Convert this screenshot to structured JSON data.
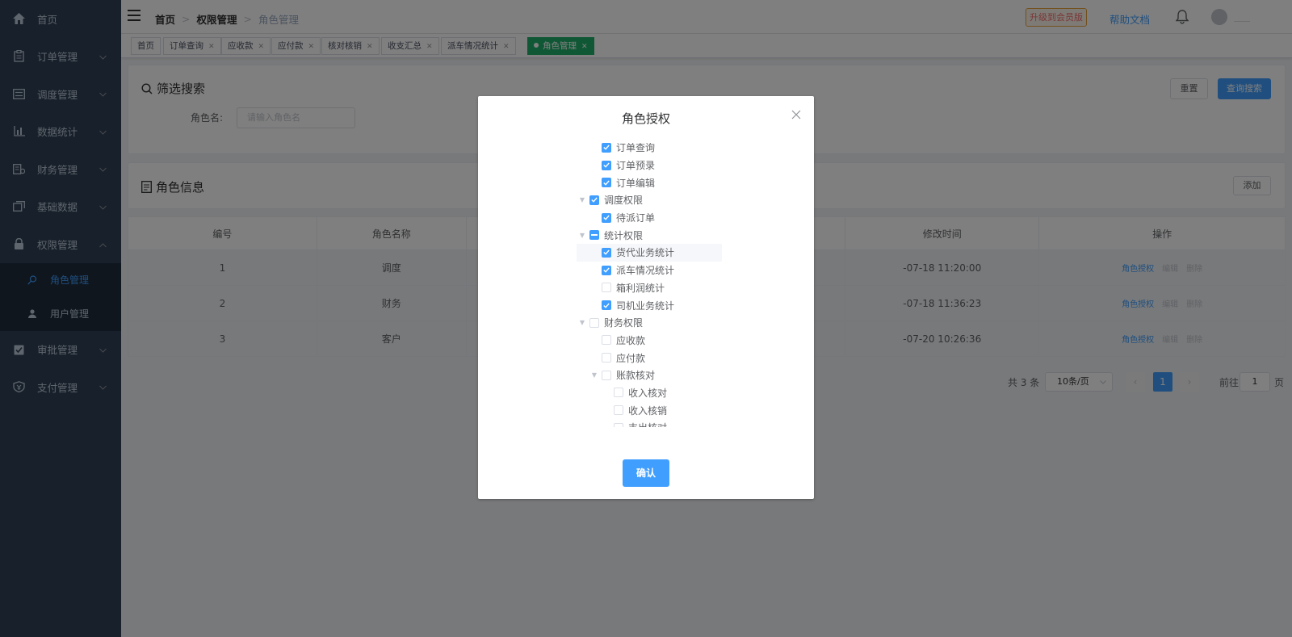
{
  "sidebar": {
    "items": [
      {
        "label": "首页",
        "icon": "home-icon",
        "has_children": false
      },
      {
        "label": "订单管理",
        "icon": "clipboard-icon",
        "has_children": true
      },
      {
        "label": "调度管理",
        "icon": "schedule-icon",
        "has_children": true
      },
      {
        "label": "数据统计",
        "icon": "chart-icon",
        "has_children": true
      },
      {
        "label": "财务管理",
        "icon": "finance-icon",
        "has_children": true
      },
      {
        "label": "基础数据",
        "icon": "database-icon",
        "has_children": true
      },
      {
        "label": "权限管理",
        "icon": "lock-icon",
        "has_children": true,
        "expanded": true
      },
      {
        "label": "审批管理",
        "icon": "approve-icon",
        "has_children": true
      },
      {
        "label": "支付管理",
        "icon": "payment-icon",
        "has_children": true
      }
    ],
    "sub_items": [
      {
        "label": "角色管理",
        "icon": "role-icon",
        "active": true
      },
      {
        "label": "用户管理",
        "icon": "user-icon",
        "active": false
      }
    ]
  },
  "topbar": {
    "breadcrumb": [
      "首页",
      "权限管理",
      "角色管理"
    ],
    "upgrade_label": "升级到会员版",
    "help_label": "帮助文档"
  },
  "tags": [
    {
      "label": "首页",
      "closable": false
    },
    {
      "label": "订单查询",
      "closable": true
    },
    {
      "label": "应收款",
      "closable": true
    },
    {
      "label": "应付款",
      "closable": true
    },
    {
      "label": "核对核销",
      "closable": true
    },
    {
      "label": "收支汇总",
      "closable": true
    },
    {
      "label": "派车情况统计",
      "closable": true
    },
    {
      "label": "角色管理",
      "closable": true,
      "active": true
    }
  ],
  "search": {
    "title": "筛选搜索",
    "role_label": "角色名:",
    "role_placeholder": "请输入角色名",
    "reset_label": "重置",
    "query_label": "查询搜索"
  },
  "roles": {
    "title": "角色信息",
    "add_label": "添加",
    "columns": [
      "编号",
      "角色名称",
      "",
      "修改时间",
      "操作"
    ],
    "rows": [
      {
        "id": "1",
        "name": "调度",
        "modified": "-07-18 11:20:00"
      },
      {
        "id": "2",
        "name": "财务",
        "modified": "-07-18 11:36:23"
      },
      {
        "id": "3",
        "name": "客户",
        "modified": "-07-20 10:26:36"
      }
    ],
    "actions": {
      "auth": "角色授权",
      "edit": "编辑",
      "delete": "删除"
    }
  },
  "pagination": {
    "total_text": "共 3 条",
    "page_size": "10条/页",
    "current_page": "1",
    "goto_label": "前往",
    "goto_value": "1",
    "page_suffix": "页"
  },
  "dialog": {
    "title": "角色授权",
    "confirm_label": "确认",
    "tree": [
      {
        "label": "订单查询",
        "level": 1,
        "state": "checked",
        "arrow": false
      },
      {
        "label": "订单预录",
        "level": 1,
        "state": "checked",
        "arrow": false
      },
      {
        "label": "订单编辑",
        "level": 1,
        "state": "checked",
        "arrow": false
      },
      {
        "label": "调度权限",
        "level": 0,
        "state": "checked",
        "arrow": true
      },
      {
        "label": "待派订单",
        "level": 1,
        "state": "checked",
        "arrow": false
      },
      {
        "label": "统计权限",
        "level": 0,
        "state": "indeterminate",
        "arrow": true
      },
      {
        "label": "货代业务统计",
        "level": 1,
        "state": "checked",
        "arrow": false,
        "highlighted": true
      },
      {
        "label": "派车情况统计",
        "level": 1,
        "state": "checked",
        "arrow": false
      },
      {
        "label": "箱利润统计",
        "level": 1,
        "state": "unchecked",
        "arrow": false
      },
      {
        "label": "司机业务统计",
        "level": 1,
        "state": "checked",
        "arrow": false
      },
      {
        "label": "财务权限",
        "level": 0,
        "state": "unchecked",
        "arrow": true
      },
      {
        "label": "应收款",
        "level": 1,
        "state": "unchecked",
        "arrow": false
      },
      {
        "label": "应付款",
        "level": 1,
        "state": "unchecked",
        "arrow": false
      },
      {
        "label": "账款核对",
        "level": 1,
        "state": "unchecked",
        "arrow": true
      },
      {
        "label": "收入核对",
        "level": 2,
        "state": "unchecked",
        "arrow": false
      },
      {
        "label": "收入核销",
        "level": 2,
        "state": "unchecked",
        "arrow": false
      },
      {
        "label": "支出核对",
        "level": 2,
        "state": "unchecked",
        "arrow": false
      }
    ]
  },
  "colors": {
    "sidebar_bg": "#304156",
    "primary": "#409eff",
    "active_tag": "#21b06b"
  }
}
